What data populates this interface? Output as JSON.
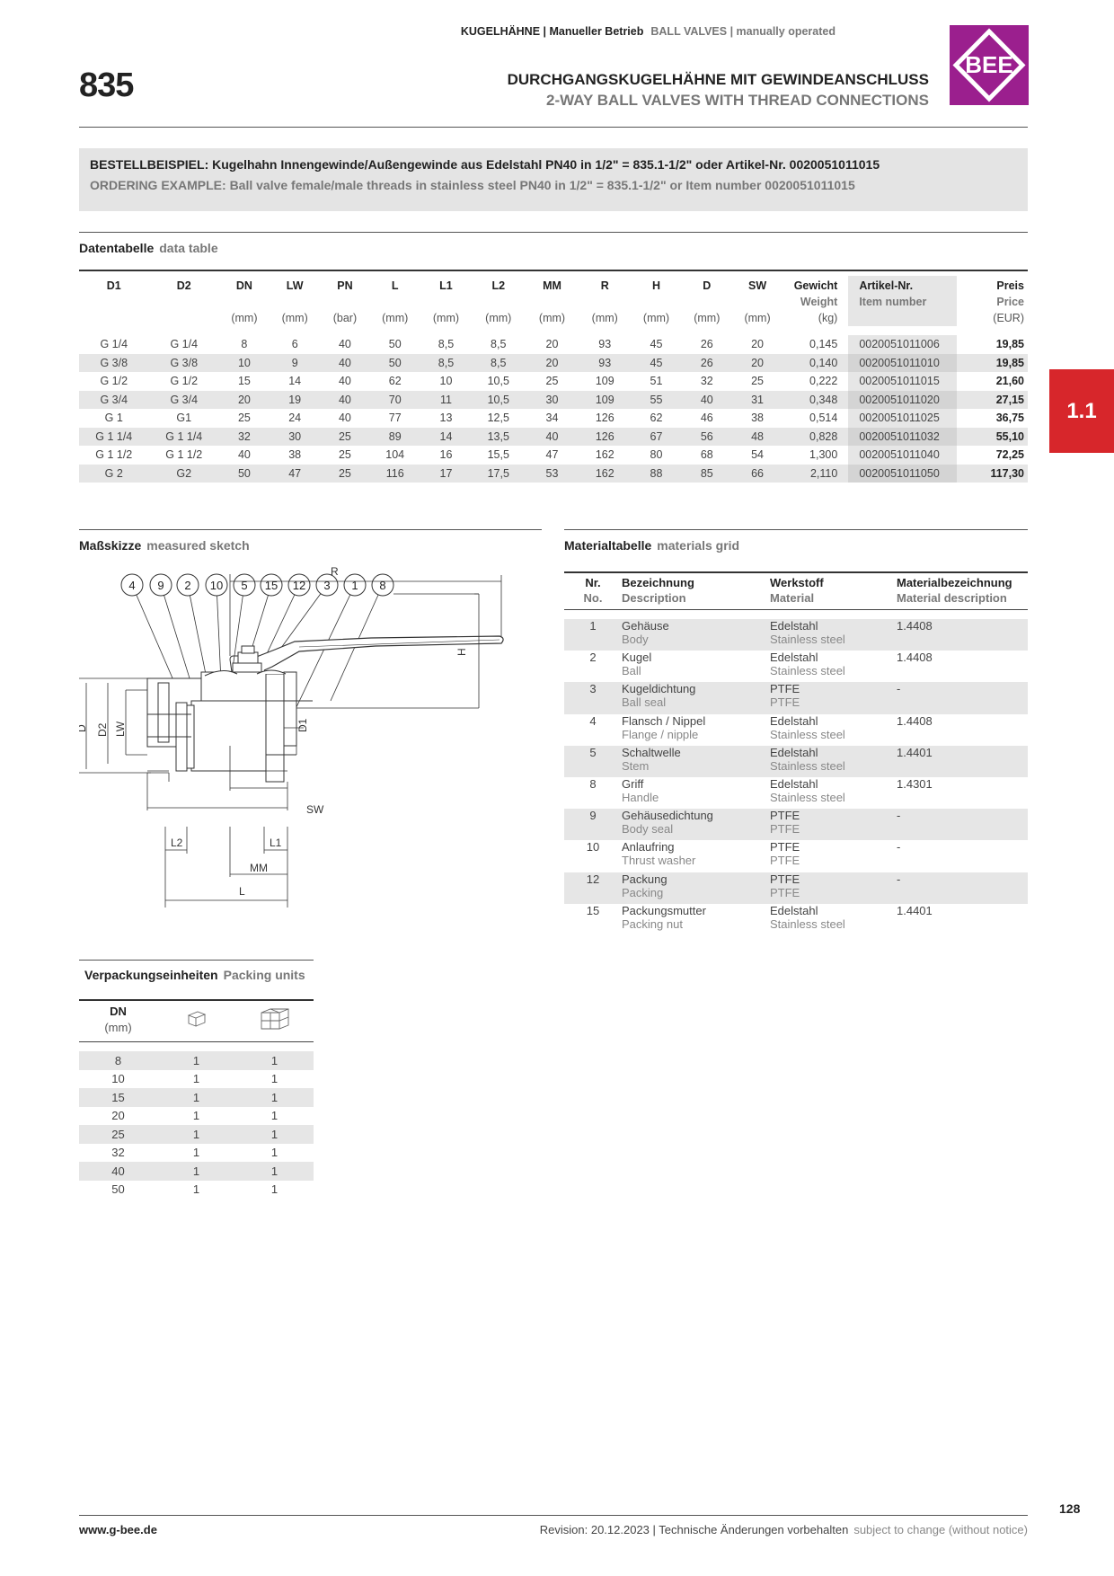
{
  "header": {
    "category_de": "KUGELHÄHNE | Manueller Betrieb",
    "category_en": "BALL VALVES | manually operated",
    "product_number": "835",
    "title_de": "DURCHGANGSKUGELHÄHNE MIT GEWINDEANSCHLUSS",
    "title_en": "2-WAY BALL VALVES WITH THREAD CONNECTIONS",
    "logo_text": "BEE",
    "logo_color": "#9b1f8e"
  },
  "order_example": {
    "de": "BESTELLBEISPIEL: Kugelhahn Innengewinde/Außengewinde aus Edelstahl PN40 in 1/2\" = 835.1-1/2\" oder Artikel-Nr. 0020051011015",
    "en": "ORDERING EXAMPLE: Ball valve female/male threads in stainless steel PN40 in 1/2\" = 835.1-1/2\" or Item number 0020051011015"
  },
  "sections": {
    "data_de": "Datentabelle",
    "data_en": "data table",
    "sketch_de": "Maßskizze",
    "sketch_en": "measured sketch",
    "materials_de": "Materialtabelle",
    "materials_en": "materials grid",
    "packing_de": "Verpackungseinheiten",
    "packing_en": "Packing units"
  },
  "data_table": {
    "headers": {
      "d1": "D1",
      "d2": "D2",
      "dn": "DN",
      "lw": "LW",
      "pn": "PN",
      "l": "L",
      "l1": "L1",
      "l2": "L2",
      "mm": "MM",
      "r": "R",
      "h": "H",
      "d": "D",
      "sw": "SW",
      "weight_de": "Gewicht",
      "weight_en": "Weight",
      "item_de": "Artikel-Nr.",
      "item_en": "Item number",
      "price_de": "Preis",
      "price_en": "Price"
    },
    "units": {
      "dn": "(mm)",
      "lw": "(mm)",
      "pn": "(bar)",
      "l": "(mm)",
      "l1": "(mm)",
      "l2": "(mm)",
      "mm": "(mm)",
      "r": "(mm)",
      "h": "(mm)",
      "d": "(mm)",
      "sw": "(mm)",
      "weight": "(kg)",
      "price": "(EUR)"
    },
    "rows": [
      [
        "G 1/4",
        "G 1/4",
        "8",
        "6",
        "40",
        "50",
        "8,5",
        "8,5",
        "20",
        "93",
        "45",
        "26",
        "20",
        "0,145",
        "0020051011006",
        "19,85"
      ],
      [
        "G 3/8",
        "G 3/8",
        "10",
        "9",
        "40",
        "50",
        "8,5",
        "8,5",
        "20",
        "93",
        "45",
        "26",
        "20",
        "0,140",
        "0020051011010",
        "19,85"
      ],
      [
        "G 1/2",
        "G 1/2",
        "15",
        "14",
        "40",
        "62",
        "10",
        "10,5",
        "25",
        "109",
        "51",
        "32",
        "25",
        "0,222",
        "0020051011015",
        "21,60"
      ],
      [
        "G 3/4",
        "G 3/4",
        "20",
        "19",
        "40",
        "70",
        "11",
        "10,5",
        "30",
        "109",
        "55",
        "40",
        "31",
        "0,348",
        "0020051011020",
        "27,15"
      ],
      [
        "G 1",
        "G1",
        "25",
        "24",
        "40",
        "77",
        "13",
        "12,5",
        "34",
        "126",
        "62",
        "46",
        "38",
        "0,514",
        "0020051011025",
        "36,75"
      ],
      [
        "G 1 1/4",
        "G 1 1/4",
        "32",
        "30",
        "25",
        "89",
        "14",
        "13,5",
        "40",
        "126",
        "67",
        "56",
        "48",
        "0,828",
        "0020051011032",
        "55,10"
      ],
      [
        "G 1 1/2",
        "G 1 1/2",
        "40",
        "38",
        "25",
        "104",
        "16",
        "15,5",
        "47",
        "162",
        "80",
        "68",
        "54",
        "1,300",
        "0020051011040",
        "72,25"
      ],
      [
        "G 2",
        "G2",
        "50",
        "47",
        "25",
        "116",
        "17",
        "17,5",
        "53",
        "162",
        "88",
        "85",
        "66",
        "2,110",
        "0020051011050",
        "117,30"
      ]
    ]
  },
  "sidebar_tab": {
    "label": "1.1",
    "color": "#d7262b"
  },
  "sketch": {
    "balloons": [
      "4",
      "9",
      "2",
      "10",
      "5",
      "15",
      "12",
      "3",
      "1",
      "8"
    ],
    "labels": {
      "r": "R",
      "h": "H",
      "d": "D",
      "d2": "D2",
      "lw": "LW",
      "d1": "D1",
      "sw": "SW",
      "l2": "L2",
      "l1": "L1",
      "mm": "MM",
      "l": "L"
    }
  },
  "materials": {
    "headers": {
      "nr_de": "Nr.",
      "nr_en": "No.",
      "name_de": "Bezeichnung",
      "name_en": "Description",
      "mat_de": "Werkstoff",
      "mat_en": "Material",
      "matdesc_de": "Materialbezeichnung",
      "matdesc_en": "Material description"
    },
    "rows": [
      {
        "nr": "1",
        "de": "Gehäuse",
        "en": "Body",
        "mat_de": "Edelstahl",
        "mat_en": "Stainless steel",
        "code": "1.4408"
      },
      {
        "nr": "2",
        "de": "Kugel",
        "en": "Ball",
        "mat_de": "Edelstahl",
        "mat_en": "Stainless steel",
        "code": "1.4408"
      },
      {
        "nr": "3",
        "de": "Kugeldichtung",
        "en": "Ball seal",
        "mat_de": "PTFE",
        "mat_en": "PTFE",
        "code": "-"
      },
      {
        "nr": "4",
        "de": "Flansch / Nippel",
        "en": "Flange / nipple",
        "mat_de": "Edelstahl",
        "mat_en": "Stainless steel",
        "code": "1.4408"
      },
      {
        "nr": "5",
        "de": "Schaltwelle",
        "en": "Stem",
        "mat_de": "Edelstahl",
        "mat_en": "Stainless steel",
        "code": "1.4401"
      },
      {
        "nr": "8",
        "de": "Griff",
        "en": "Handle",
        "mat_de": "Edelstahl",
        "mat_en": "Stainless steel",
        "code": "1.4301"
      },
      {
        "nr": "9",
        "de": "Gehäusedichtung",
        "en": "Body seal",
        "mat_de": "PTFE",
        "mat_en": "PTFE",
        "code": "-"
      },
      {
        "nr": "10",
        "de": "Anlaufring",
        "en": "Thrust washer",
        "mat_de": "PTFE",
        "mat_en": "PTFE",
        "code": "-"
      },
      {
        "nr": "12",
        "de": "Packung",
        "en": "Packing",
        "mat_de": "PTFE",
        "mat_en": "PTFE",
        "code": "-"
      },
      {
        "nr": "15",
        "de": "Packungsmutter",
        "en": "Packing nut",
        "mat_de": "Edelstahl",
        "mat_en": "Stainless steel",
        "code": "1.4401"
      }
    ]
  },
  "packing": {
    "header_dn": "DN",
    "header_unit": "(mm)",
    "icon_single": "single-box-icon",
    "icon_multi": "multi-box-icon",
    "rows": [
      [
        "8",
        "1",
        "1"
      ],
      [
        "10",
        "1",
        "1"
      ],
      [
        "15",
        "1",
        "1"
      ],
      [
        "20",
        "1",
        "1"
      ],
      [
        "25",
        "1",
        "1"
      ],
      [
        "32",
        "1",
        "1"
      ],
      [
        "40",
        "1",
        "1"
      ],
      [
        "50",
        "1",
        "1"
      ]
    ]
  },
  "footer": {
    "website": "www.g-bee.de",
    "revision_de": "Revision: 20.12.2023 | Technische Änderungen vorbehalten",
    "revision_en": "subject to change (without notice)",
    "page": "128"
  }
}
